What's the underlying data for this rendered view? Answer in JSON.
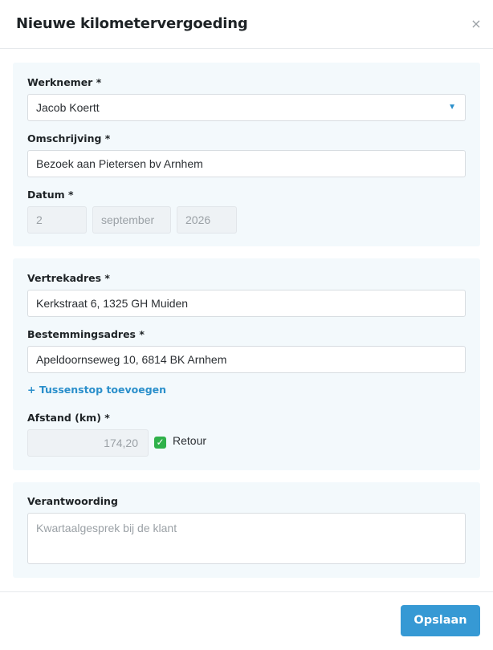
{
  "dialog": {
    "title": "Nieuwe kilometervergoeding",
    "close_icon": "×"
  },
  "section1": {
    "employee_label": "Werknemer *",
    "employee_value": "Jacob Koertt",
    "employee_caret": "▼",
    "description_label": "Omschrijving *",
    "description_value": "Bezoek aan Pietersen bv Arnhem",
    "date_label": "Datum *",
    "date_day": "2",
    "date_month": "september",
    "date_year": "2026"
  },
  "section2": {
    "departure_label": "Vertrekadres *",
    "departure_value": "Kerkstraat 6, 1325 GH Muiden",
    "destination_label": "Bestemmingsadres *",
    "destination_value": "Apeldoornseweg 10, 6814 BK Arnhem",
    "add_stop_link": "+ Tussenstop toevoegen",
    "distance_label": "Afstand (km) *",
    "distance_value": "174,20",
    "return_checked": true,
    "return_check_glyph": "✓",
    "return_label": "Retour"
  },
  "section3": {
    "justification_label": "Verantwoording",
    "justification_placeholder": "Kwartaalgesprek bij de klant"
  },
  "footer": {
    "save_label": "Opslaan"
  },
  "colors": {
    "accent": "#3699d4",
    "link": "#2a8fcb",
    "section_bg": "#f3f9fc",
    "checkbox": "#2fb14a"
  }
}
